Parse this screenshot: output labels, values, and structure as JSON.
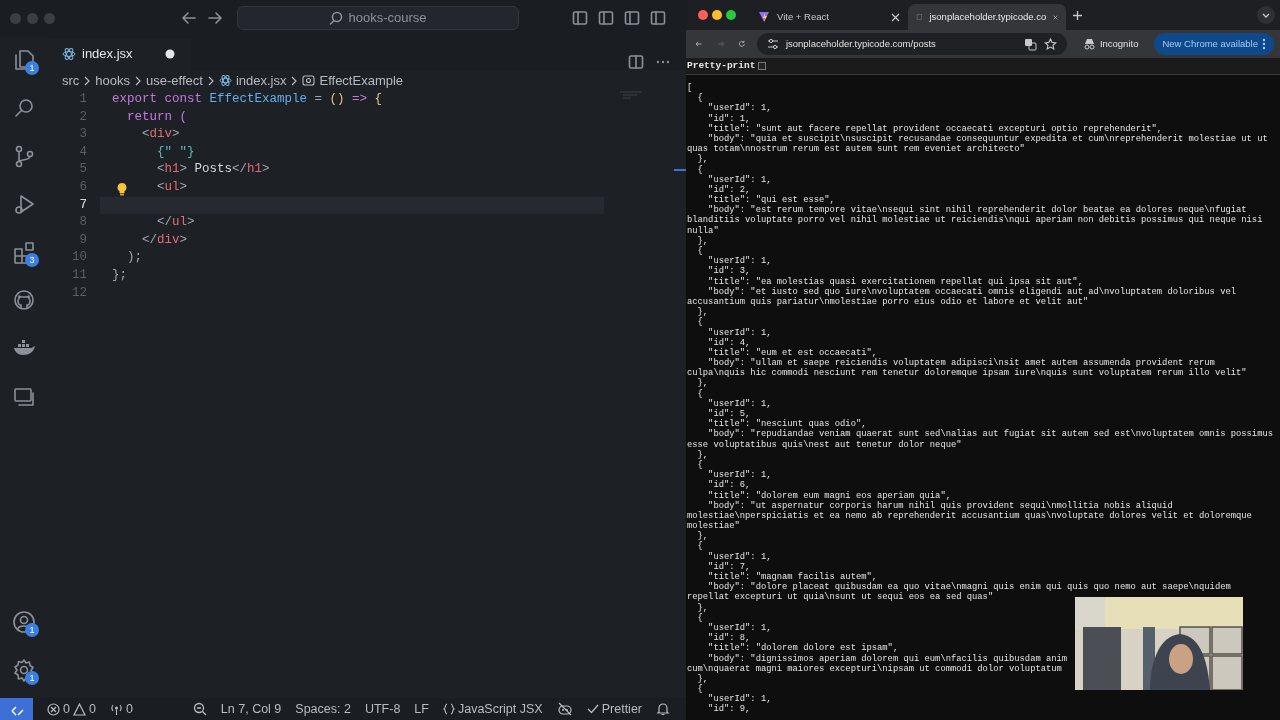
{
  "editor": {
    "search": "hooks-course",
    "activity_items": [
      {
        "kind": "files",
        "badge": "1"
      },
      {
        "kind": "search"
      },
      {
        "kind": "source-control"
      },
      {
        "kind": "run-debug"
      },
      {
        "kind": "extensions",
        "badge": "3"
      },
      {
        "kind": "github"
      },
      {
        "kind": "docker"
      },
      {
        "kind": "remote"
      }
    ],
    "activity_bottom": [
      {
        "kind": "account",
        "badge": "1"
      },
      {
        "kind": "settings",
        "badge": "1"
      }
    ],
    "tabs": [
      {
        "label": "index.jsx",
        "selected": true,
        "modified": true
      }
    ],
    "breadcrumb": [
      {
        "label": "src",
        "kind": "folder"
      },
      {
        "label": "hooks",
        "kind": "folder"
      },
      {
        "label": "use-effect",
        "kind": "folder"
      },
      {
        "label": "index.jsx",
        "kind": "file"
      },
      {
        "label": "EffectExample",
        "kind": "symbol"
      }
    ],
    "code_lines": [
      {
        "number": "1",
        "current": false,
        "lightbulb": false,
        "tokens": [
          {
            "text": "export",
            "kind": "keyword"
          },
          {
            "text": " const",
            "kind": "keyword"
          },
          {
            "text": " EffectExample",
            "kind": "name"
          },
          {
            "text": " =",
            "kind": "operator"
          },
          {
            "text": " ()",
            "kind": "bracket"
          },
          {
            "text": " =>",
            "kind": "keyword"
          },
          {
            "text": " {",
            "kind": "bracket"
          }
        ]
      },
      {
        "number": "2",
        "current": false,
        "lightbulb": false,
        "tokens": [
          {
            "text": "  return",
            "kind": "keyword"
          },
          {
            "text": " (",
            "kind": "keyword"
          }
        ]
      },
      {
        "number": "3",
        "current": false,
        "lightbulb": false,
        "tokens": [
          {
            "text": "    <",
            "kind": "punct"
          },
          {
            "text": "div",
            "kind": "tag"
          },
          {
            "text": ">",
            "kind": "punct"
          }
        ]
      },
      {
        "number": "4",
        "current": false,
        "lightbulb": false,
        "tokens": [
          {
            "text": "      {\" \"}",
            "kind": "string"
          }
        ]
      },
      {
        "number": "5",
        "current": false,
        "lightbulb": false,
        "tokens": [
          {
            "text": "      <",
            "kind": "punct"
          },
          {
            "text": "h1",
            "kind": "tag"
          },
          {
            "text": ">",
            "kind": "punct"
          },
          {
            "text": " Posts",
            "kind": "text"
          },
          {
            "text": "</",
            "kind": "punct"
          },
          {
            "text": "h1",
            "kind": "tag"
          },
          {
            "text": ">",
            "kind": "punct"
          }
        ]
      },
      {
        "number": "6",
        "current": false,
        "lightbulb": true,
        "tokens": [
          {
            "text": "      <",
            "kind": "punct"
          },
          {
            "text": "ul",
            "kind": "tag"
          },
          {
            "text": ">",
            "kind": "punct"
          }
        ]
      },
      {
        "number": "7",
        "current": true,
        "lightbulb": false
      },
      {
        "number": "8",
        "current": false,
        "lightbulb": false,
        "tokens": [
          {
            "text": "      </",
            "kind": "punct"
          },
          {
            "text": "ul",
            "kind": "tag"
          },
          {
            "text": ">",
            "kind": "punct"
          }
        ]
      },
      {
        "number": "9",
        "current": false,
        "lightbulb": false,
        "tokens": [
          {
            "text": "    </",
            "kind": "punct"
          },
          {
            "text": "div",
            "kind": "tag"
          },
          {
            "text": ">",
            "kind": "punct"
          }
        ]
      },
      {
        "number": "10",
        "current": false,
        "lightbulb": false,
        "tokens": [
          {
            "text": "  );",
            "kind": "punct"
          }
        ]
      },
      {
        "number": "11",
        "current": false,
        "lightbulb": false,
        "tokens": [
          {
            "text": "};",
            "kind": "punct"
          }
        ]
      },
      {
        "number": "12",
        "current": false,
        "lightbulb": false
      }
    ],
    "status_bar": [
      {
        "kind": "remote"
      },
      {
        "kind": "problems",
        "errors": "0",
        "warnings": "0"
      },
      {
        "kind": "ports",
        "text": "0"
      },
      {
        "kind": "zoom"
      },
      {
        "kind": "text",
        "text": "Ln 7, Col 9"
      },
      {
        "kind": "text",
        "text": "Spaces: 2"
      },
      {
        "kind": "text",
        "text": "UTF-8"
      },
      {
        "kind": "text",
        "text": "LF"
      },
      {
        "kind": "language",
        "text": "JavaScript JSX"
      },
      {
        "kind": "copilot"
      },
      {
        "kind": "prettier",
        "text": "Prettier"
      },
      {
        "kind": "bell"
      }
    ]
  },
  "browser": {
    "tabs": [
      {
        "label": "Vite + React",
        "selected": false,
        "kind": "vite"
      },
      {
        "label": "jsonplaceholder.typicode.co",
        "selected": true,
        "kind": "page"
      }
    ],
    "nav": [
      {
        "kind": "back",
        "disabled": false
      },
      {
        "kind": "forward",
        "disabled": true
      },
      {
        "kind": "reload",
        "disabled": false
      }
    ],
    "address": "jsonplaceholder.typicode.com/posts",
    "profile": "Incognito",
    "update_button": "New Chrome available",
    "pretty_print": {
      "label": "Pretty-print",
      "checked": false
    },
    "response_lines": [
      "[",
      "  {",
      "    \"userId\": 1,",
      "    \"id\": 1,",
      "    \"title\": \"sunt aut facere repellat provident occaecati excepturi optio reprehenderit\",",
      "    \"body\": \"quia et suscipit\\nsuscipit recusandae consequuntur expedita et cum\\nreprehenderit molestiae ut ut",
      "quas totam\\nnostrum rerum est autem sunt rem eveniet architecto\"",
      "  },",
      "  {",
      "    \"userId\": 1,",
      "    \"id\": 2,",
      "    \"title\": \"qui est esse\",",
      "    \"body\": \"est rerum tempore vitae\\nsequi sint nihil reprehenderit dolor beatae ea dolores neque\\nfugiat",
      "blanditiis voluptate porro vel nihil molestiae ut reiciendis\\nqui aperiam non debitis possimus qui neque nisi",
      "nulla\"",
      "  },",
      "  {",
      "    \"userId\": 1,",
      "    \"id\": 3,",
      "    \"title\": \"ea molestias quasi exercitationem repellat qui ipsa sit aut\",",
      "    \"body\": \"et iusto sed quo iure\\nvoluptatem occaecati omnis eligendi aut ad\\nvoluptatem doloribus vel",
      "accusantium quis pariatur\\nmolestiae porro eius odio et labore et velit aut\"",
      "  },",
      "  {",
      "    \"userId\": 1,",
      "    \"id\": 4,",
      "    \"title\": \"eum et est occaecati\",",
      "    \"body\": \"ullam et saepe reiciendis voluptatem adipisci\\nsit amet autem assumenda provident rerum",
      "culpa\\nquis hic commodi nesciunt rem tenetur doloremque ipsam iure\\nquis sunt voluptatem rerum illo velit\"",
      "  },",
      "  {",
      "    \"userId\": 1,",
      "    \"id\": 5,",
      "    \"title\": \"nesciunt quas odio\",",
      "    \"body\": \"repudiandae veniam quaerat sunt sed\\nalias aut fugiat sit autem sed est\\nvoluptatem omnis possimus",
      "esse voluptatibus quis\\nest aut tenetur dolor neque\"",
      "  },",
      "  {",
      "    \"userId\": 1,",
      "    \"id\": 6,",
      "    \"title\": \"dolorem eum magni eos aperiam quia\",",
      "    \"body\": \"ut aspernatur corporis harum nihil quis provident sequi\\nmollitia nobis aliquid",
      "molestiae\\nperspiciatis et ea nemo ab reprehenderit accusantium quas\\nvoluptate dolores velit et doloremque",
      "molestiae\"",
      "  },",
      "  {",
      "    \"userId\": 1,",
      "    \"id\": 7,",
      "    \"title\": \"magnam facilis autem\",",
      "    \"body\": \"dolore placeat quibusdam ea quo vitae\\nmagni quis enim qui quis quo nemo aut saepe\\nquidem",
      "repellat excepturi ut quia\\nsunt ut sequi eos ea sed quas\"",
      "  },",
      "  {",
      "    \"userId\": 1,",
      "    \"id\": 8,",
      "    \"title\": \"dolorem dolore est ipsam\",",
      "    \"body\": \"dignissimos aperiam dolorem qui eum\\nfacilis quibusdam anim",
      "cum\\nquaerat magni maiores excepturi\\nipsam ut commodi dolor voluptatum",
      "  },",
      "  {",
      "    \"userId\": 1,",
      "    \"id\": 9,"
    ]
  }
}
